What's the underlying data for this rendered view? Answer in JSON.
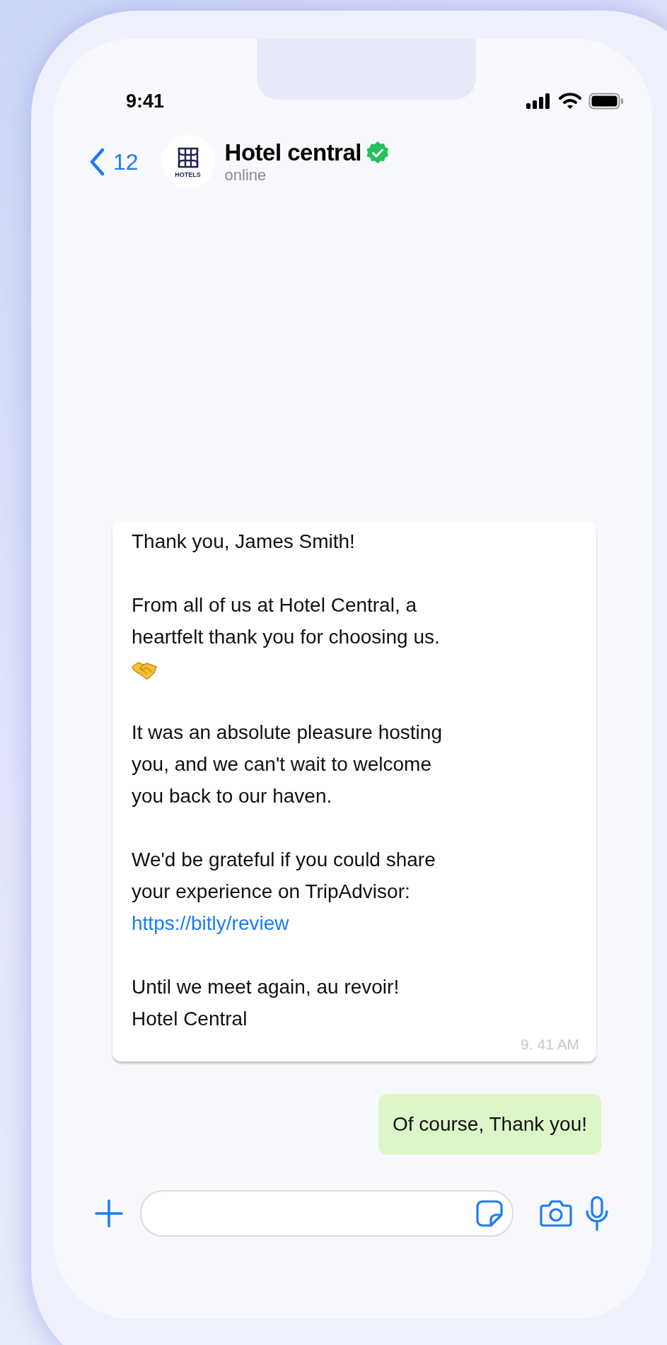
{
  "status_bar": {
    "time": "9:41"
  },
  "header": {
    "back_count": "12",
    "avatar_label": "HOTELS",
    "name": "Hotel central",
    "verified": true,
    "status": "online"
  },
  "messages": [
    {
      "kind": "incoming",
      "paragraphs": [
        {
          "lines": [
            "Thank you, James Smith!"
          ]
        },
        {
          "lines": [
            "From all of us at Hotel Central, a",
            "heartfelt thank you for choosing us."
          ],
          "emoji": true
        },
        {
          "lines": [
            "It was an absolute pleasure hosting",
            "you, and we can't wait to welcome",
            "you back to our haven."
          ]
        },
        {
          "lines": [
            "We'd be grateful if you could share",
            "your experience on TripAdvisor:"
          ],
          "link": "https://bitly/review"
        },
        {
          "lines": [
            "Until we meet again, au revoir!",
            "Hotel Central"
          ]
        }
      ],
      "time": "9. 41 AM"
    },
    {
      "kind": "outgoing",
      "paragraphs": [
        {
          "lines": [
            "Of course, Thank you!"
          ]
        }
      ]
    }
  ]
}
